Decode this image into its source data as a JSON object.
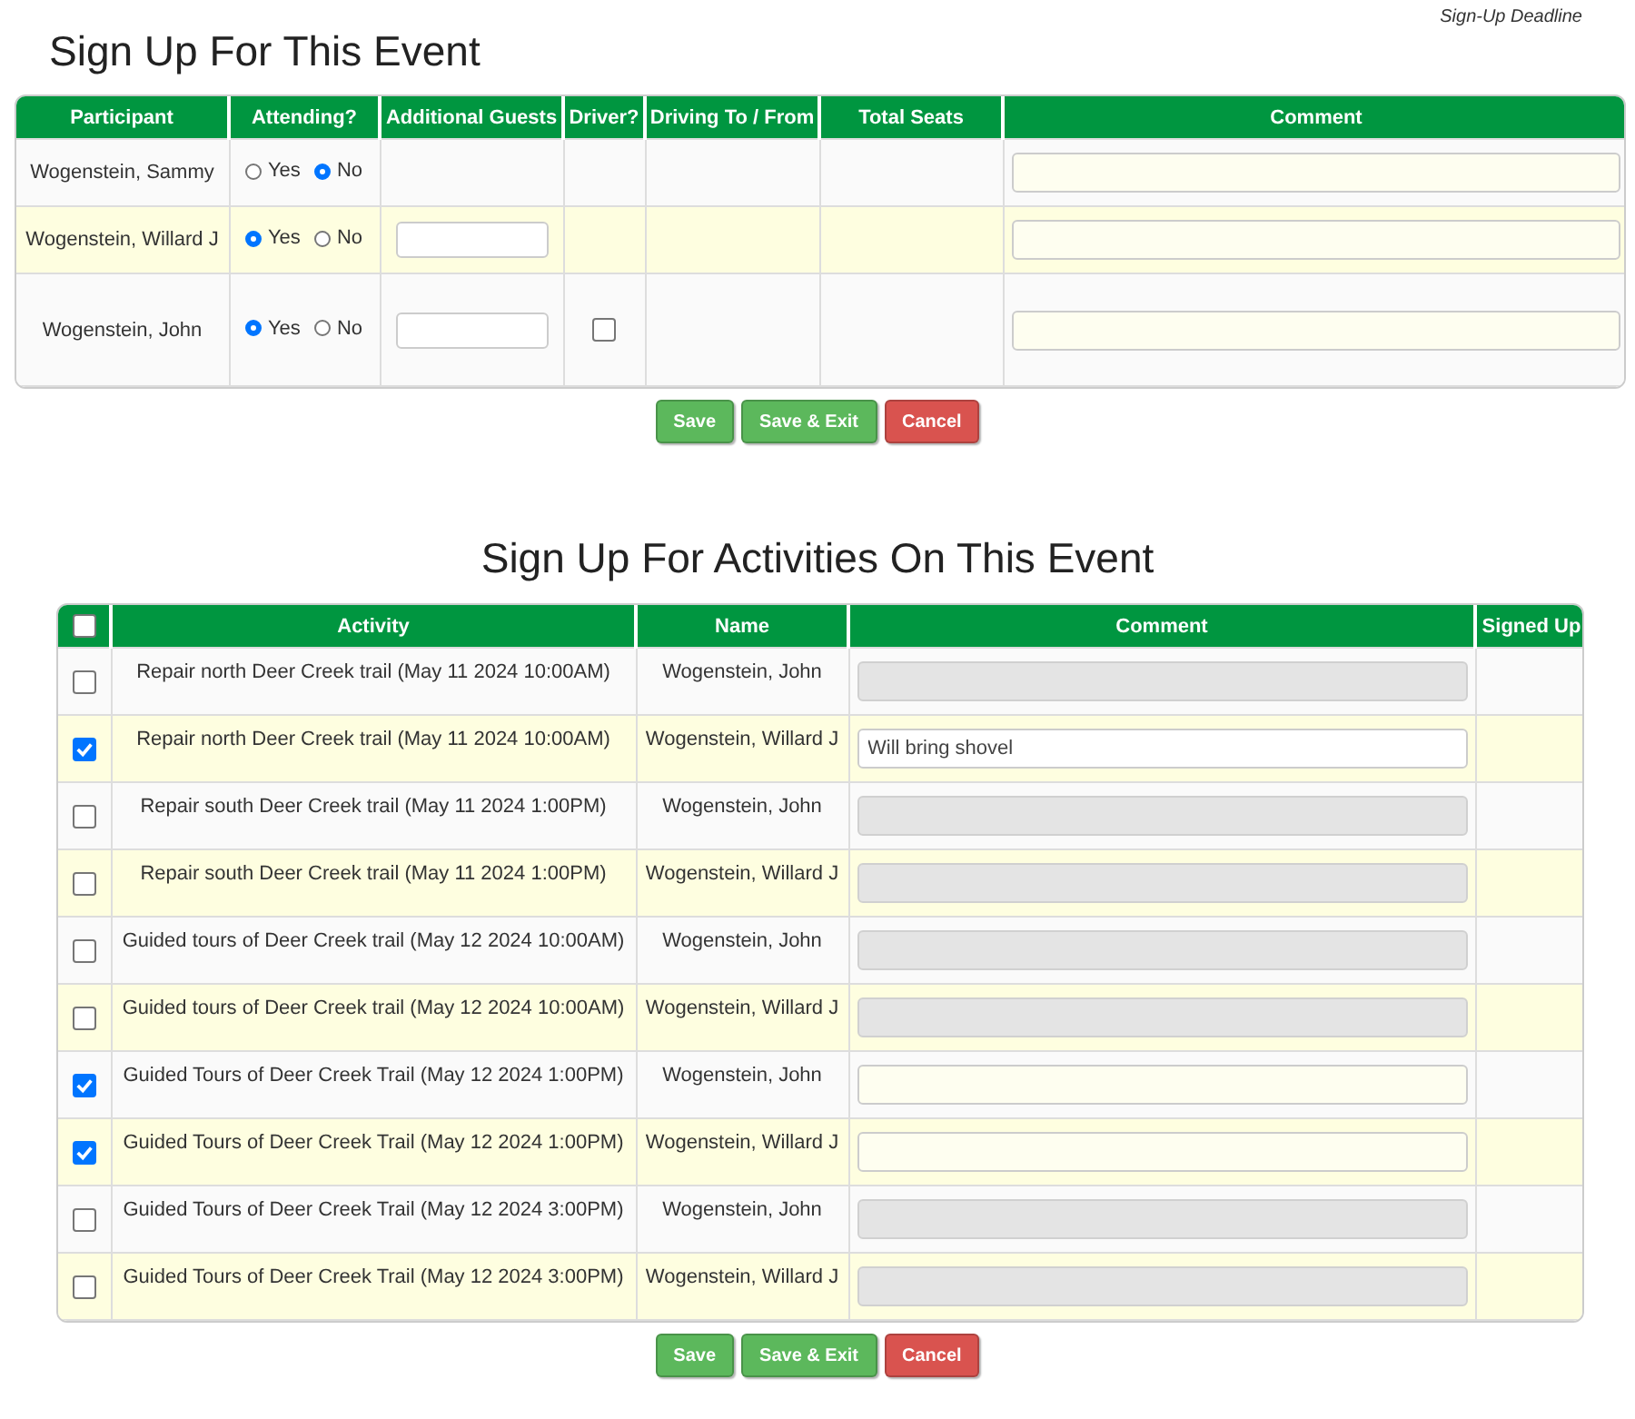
{
  "deadline_label": "Sign-Up Deadline",
  "event": {
    "title": "Sign Up For This Event",
    "columns": [
      "Participant",
      "Attending?",
      "Additional Guests",
      "Driver?",
      "Driving To / From",
      "Total Seats",
      "Comment"
    ],
    "rows": [
      {
        "participant": "Wogenstein, Sammy",
        "options": [
          {
            "label": "Yes",
            "selected": false
          },
          {
            "label": "No",
            "selected": true
          }
        ],
        "guests_field": false
      },
      {
        "participant": "Wogenstein, Willard J",
        "options": [
          {
            "label": "Yes",
            "selected": true
          },
          {
            "label": "No",
            "selected": false
          }
        ],
        "guests_field": true
      },
      {
        "participant": "Wogenstein, John",
        "options": [
          {
            "label": "Yes",
            "selected": true
          },
          {
            "label": "No",
            "selected": false
          }
        ],
        "guests_field": true,
        "driver": {
          "checked": false
        }
      }
    ],
    "buttons": [
      {
        "label": "Save",
        "kind": "save"
      },
      {
        "label": "Save & Exit",
        "kind": "save"
      },
      {
        "label": "Cancel",
        "kind": "cancel"
      }
    ]
  },
  "activities": {
    "title": "Sign Up For Activities On This Event",
    "select_all": {
      "checked": false
    },
    "columns": [
      "Activity",
      "Name",
      "Comment",
      "Signed Up"
    ],
    "rows": [
      {
        "checked": false,
        "activity": "Repair north Deer Creek trail (May 11 2024 10:00AM)",
        "name": "Wogenstein, John",
        "comment_disabled": true
      },
      {
        "checked": true,
        "activity": "Repair north Deer Creek trail (May 11 2024 10:00AM)",
        "name": "Wogenstein, Willard J",
        "comment_disabled": false,
        "comment": "Will bring shovel"
      },
      {
        "checked": false,
        "activity": "Repair south Deer Creek trail (May 11 2024 1:00PM)",
        "name": "Wogenstein, John",
        "comment_disabled": true
      },
      {
        "checked": false,
        "activity": "Repair south Deer Creek trail (May 11 2024 1:00PM)",
        "name": "Wogenstein, Willard J",
        "comment_disabled": true
      },
      {
        "checked": false,
        "activity": "Guided tours of Deer Creek trail (May 12 2024 10:00AM)",
        "name": "Wogenstein, John",
        "comment_disabled": true
      },
      {
        "checked": false,
        "activity": "Guided tours of Deer Creek trail (May 12 2024 10:00AM)",
        "name": "Wogenstein, Willard J",
        "comment_disabled": true
      },
      {
        "checked": true,
        "activity": "Guided Tours of Deer Creek Trail (May 12 2024 1:00PM)",
        "name": "Wogenstein, John",
        "comment_disabled": false
      },
      {
        "checked": true,
        "activity": "Guided Tours of Deer Creek Trail (May 12 2024 1:00PM)",
        "name": "Wogenstein, Willard J",
        "comment_disabled": false
      },
      {
        "checked": false,
        "activity": "Guided Tours of Deer Creek Trail (May 12 2024 3:00PM)",
        "name": "Wogenstein, John",
        "comment_disabled": true
      },
      {
        "checked": false,
        "activity": "Guided Tours of Deer Creek Trail (May 12 2024 3:00PM)",
        "name": "Wogenstein, Willard J",
        "comment_disabled": true
      }
    ],
    "buttons": [
      {
        "label": "Save",
        "kind": "save"
      },
      {
        "label": "Save & Exit",
        "kind": "save"
      },
      {
        "label": "Cancel",
        "kind": "cancel"
      }
    ]
  }
}
